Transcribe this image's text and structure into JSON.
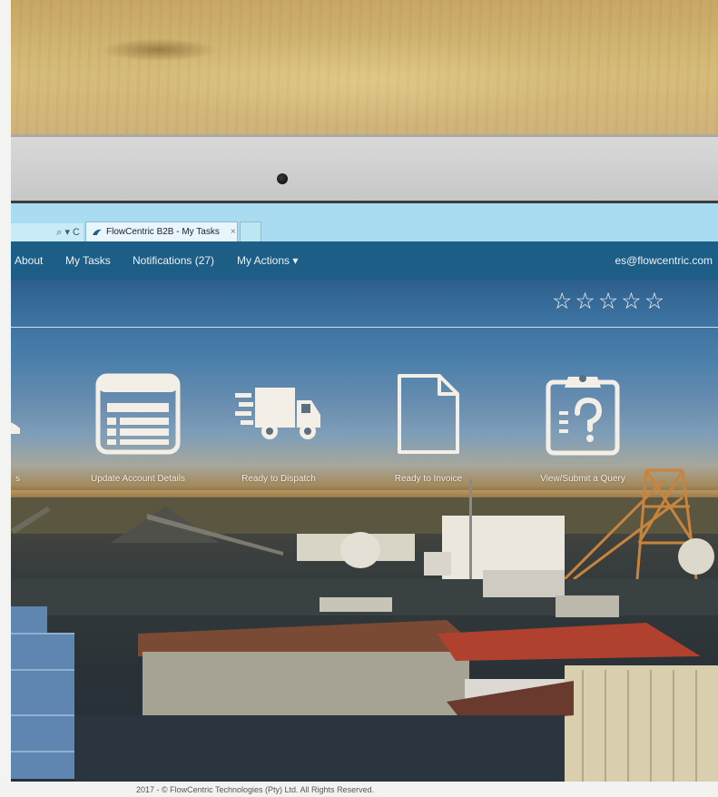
{
  "browser": {
    "address_icons": "⌕ ▾ C",
    "tab_title": "FlowCentric B2B - My Tasks",
    "tab_close": "×"
  },
  "nav": {
    "items": [
      "About",
      "My Tasks",
      "Notifications (27)",
      "My Actions ▾"
    ],
    "user": "es@flowcentric.com"
  },
  "rating": {
    "stars": [
      "☆",
      "☆",
      "☆",
      "☆",
      "☆"
    ],
    "value": 0,
    "max": 5
  },
  "tiles": [
    {
      "label": "s",
      "icon": "user-icon"
    },
    {
      "label": "Update Account Details",
      "icon": "account-details-icon"
    },
    {
      "label": "Ready to Dispatch",
      "icon": "delivery-truck-icon"
    },
    {
      "label": "Ready to Invoice",
      "icon": "document-icon"
    },
    {
      "label": "View/Submit a Query",
      "icon": "clipboard-query-icon"
    }
  ],
  "footer": {
    "copyright": "2017 - © FlowCentric Technologies (Pty) Ltd. All Rights Reserved."
  },
  "colors": {
    "nav": "#1d5e86",
    "browser_bar": "#a9dcf0",
    "icon_stroke": "#f4efe6"
  }
}
